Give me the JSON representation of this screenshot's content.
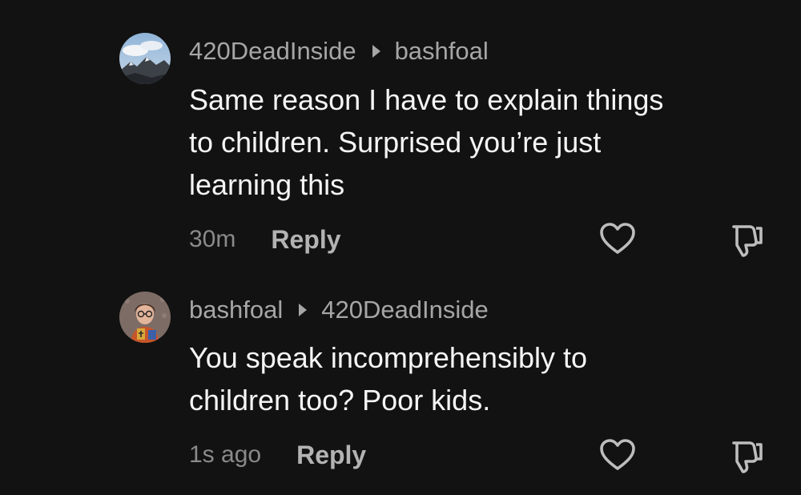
{
  "comments": [
    {
      "author": "420DeadInside",
      "reply_to": "bashfoal",
      "text_lines": [
        "Same reason I have to explain things",
        "to children. Surprised you’re just",
        "learning this"
      ],
      "time": "30m",
      "reply_label": "Reply",
      "avatar_icon": "mountain-sky-avatar"
    },
    {
      "author": "bashfoal",
      "reply_to": "420DeadInside",
      "text_lines": [
        "You speak incomprehensibly to",
        "children too? Poor kids."
      ],
      "time": "1s ago",
      "reply_label": "Reply",
      "avatar_icon": "person-glasses-avatar"
    }
  ],
  "icons": {
    "like": "heart-icon",
    "dislike": "thumbs-down-icon",
    "reply_arrow": "caret-right-icon"
  },
  "colors": {
    "background": "#121212",
    "primary_text": "#f5f5f5",
    "secondary_text": "#a6a6a6",
    "timestamp": "#8a8a8a"
  }
}
